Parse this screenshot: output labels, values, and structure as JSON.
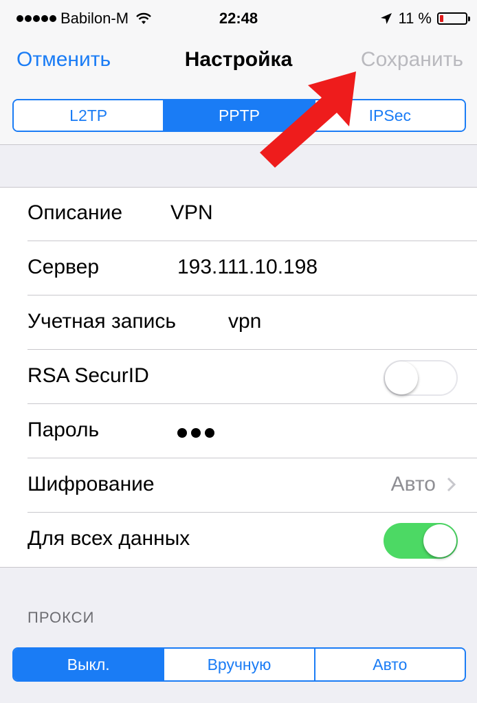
{
  "status_bar": {
    "carrier": "Babilon-M",
    "time": "22:48",
    "battery_percent": "11 %",
    "battery_color": "#e01b1b"
  },
  "nav": {
    "cancel": "Отменить",
    "title": "Настройка",
    "save": "Сохранить"
  },
  "vpn_type": {
    "options": [
      "L2TP",
      "PPTP",
      "IPSec"
    ],
    "selected": "PPTP"
  },
  "fields": {
    "description": {
      "label": "Описание",
      "value": "VPN"
    },
    "server": {
      "label": "Сервер",
      "value": "193.111.10.198"
    },
    "account": {
      "label": "Учетная запись",
      "value": "vpn"
    },
    "rsa": {
      "label": "RSA SecurID",
      "enabled": false
    },
    "password": {
      "label": "Пароль"
    },
    "encryption": {
      "label": "Шифрование",
      "value": "Авто"
    },
    "send_all": {
      "label": "Для всех данных",
      "enabled": true
    }
  },
  "proxy": {
    "header": "ПРОКСИ",
    "options": [
      "Выкл.",
      "Вручную",
      "Авто"
    ],
    "selected": "Выкл."
  },
  "colors": {
    "accent": "#1a7cf5",
    "toggle_on": "#4cd964",
    "annotation_arrow": "#ee1c1c"
  }
}
